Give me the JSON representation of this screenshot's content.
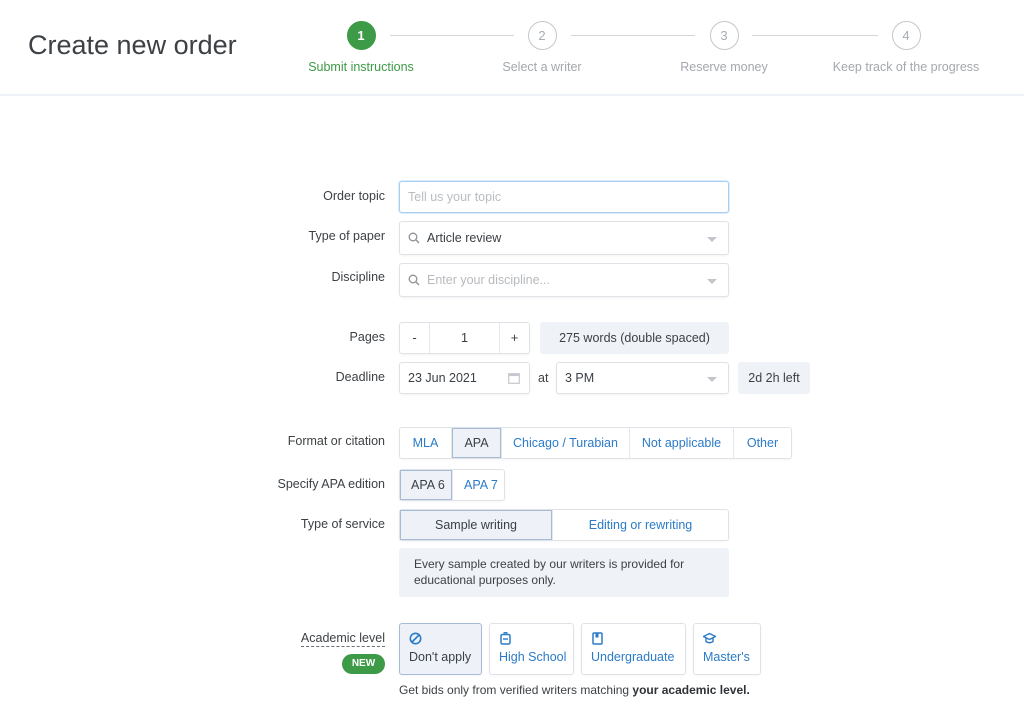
{
  "header": {
    "title": "Create new order",
    "steps": [
      {
        "number": "1",
        "label": "Submit instructions",
        "active": true
      },
      {
        "number": "2",
        "label": "Select a writer",
        "active": false
      },
      {
        "number": "3",
        "label": "Reserve money",
        "active": false
      },
      {
        "number": "4",
        "label": "Keep track of the progress",
        "active": false
      }
    ]
  },
  "form": {
    "order_topic": {
      "label": "Order topic",
      "placeholder": "Tell us your topic",
      "value": ""
    },
    "type_of_paper": {
      "label": "Type of paper",
      "value": "Article review",
      "icon": "search-icon"
    },
    "discipline": {
      "label": "Discipline",
      "placeholder": "Enter your discipline...",
      "icon": "search-icon"
    },
    "pages": {
      "label": "Pages",
      "minus": "-",
      "value": "1",
      "plus": "+",
      "words_info": "275 words (double spaced)"
    },
    "deadline": {
      "label": "Deadline",
      "date": "23 Jun 2021",
      "at_label": "at",
      "time": "3 PM",
      "time_left": "2d 2h left"
    },
    "format": {
      "label": "Format or citation",
      "options": [
        "MLA",
        "APA",
        "Chicago / Turabian",
        "Not applicable",
        "Other"
      ],
      "selected": "APA"
    },
    "apa_edition": {
      "label": "Specify APA edition",
      "options": [
        "APA 6",
        "APA 7"
      ],
      "selected": "APA 6"
    },
    "service": {
      "label": "Type of service",
      "options": [
        "Sample writing",
        "Editing or rewriting"
      ],
      "selected": "Sample writing",
      "note": "Every sample created by our writers is provided for educational purposes only."
    },
    "academic_level": {
      "label": "Academic level",
      "badge": "NEW",
      "options": [
        {
          "label": "Don't apply",
          "icon": "ban-icon"
        },
        {
          "label": "High School",
          "icon": "backpack-icon"
        },
        {
          "label": "Undergraduate",
          "icon": "book-icon"
        },
        {
          "label": "Master's",
          "icon": "graduation-cap-icon"
        }
      ],
      "selected": "Don't apply",
      "hint_prefix": "Get bids only from verified writers matching ",
      "hint_bold": "your academic level."
    }
  },
  "colors": {
    "accent_green": "#3d9a46",
    "link_blue": "#2b7bc7",
    "selected_bg": "#eef2f8",
    "info_bg": "#eff2f6"
  }
}
